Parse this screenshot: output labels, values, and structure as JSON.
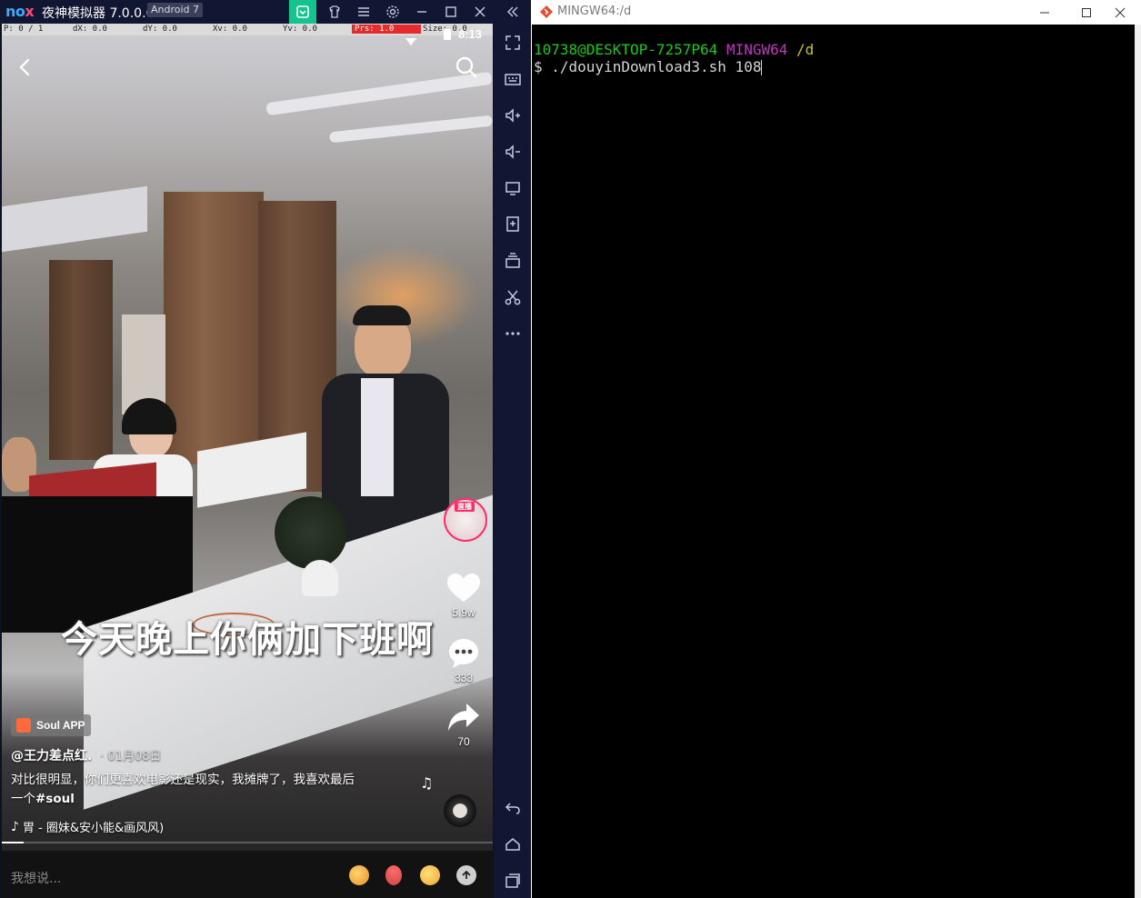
{
  "nox": {
    "title": "夜神模拟器 7.0.0.6",
    "android_badge": "Android 7",
    "logo_text": "nox",
    "titlebar_icons": [
      "notification-active-icon",
      "shirt-skin-icon",
      "menu-icon",
      "gear-icon",
      "minimize-icon",
      "maximize-icon",
      "close-icon",
      "collapse-sidebar-icon"
    ],
    "accent": "#14c38e",
    "devbar": {
      "p": "P: 0 / 1",
      "dx": "dX: 0.0",
      "dy": "dY: 0.0",
      "xv": "Xv: 0.0",
      "yv": "Yv: 0.0",
      "prs": "Prs: 1.0",
      "size": "Size: 0.0"
    },
    "status_time": "8:13",
    "video": {
      "subtitle": "今天晚上你俩加下班啊",
      "live_badge": "直播",
      "likes": "5.9w",
      "comments": "333",
      "shares": "70",
      "sponsor_tag": "Soul APP",
      "author": "@王力差点红.",
      "date": "· 01月08日",
      "caption_line1": "对比很明显，你们更喜欢电影还是现实，我摊牌了，我喜欢最后",
      "caption_line2": "一个",
      "caption_hashtag": "#soul",
      "music": "胃 - 圈妹&安小能&画风风)",
      "comment_placeholder": "我想说..."
    },
    "side_toolbar": [
      "fullscreen-icon",
      "keyboard-icon",
      "volume-up-icon",
      "volume-down-icon",
      "screen-icon",
      "apk-install-icon",
      "multi-instance-icon",
      "scissors-icon",
      "more-icon",
      "back-icon",
      "home-icon",
      "recent-apps-icon"
    ]
  },
  "terminal": {
    "title": "MINGW64:/d",
    "prompt_user": "10738@DESKTOP-7257P64",
    "prompt_env": "MINGW64",
    "prompt_path": "/d",
    "command_prefix": "$ ",
    "command": "./douyinDownload3.sh 108",
    "colors": {
      "user": "#1cc61c",
      "env": "#c334c3",
      "path": "#c7c329",
      "text": "#d4d4d4"
    }
  }
}
